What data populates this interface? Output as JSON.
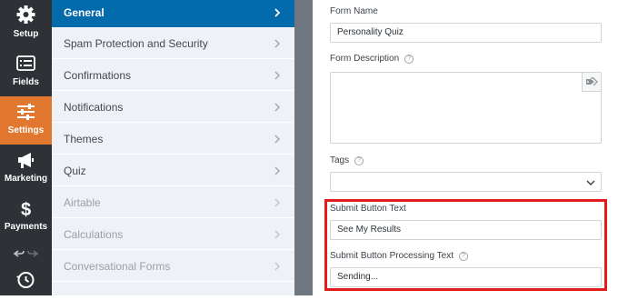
{
  "sidebar": {
    "items": [
      {
        "label": "Setup",
        "icon": "gear-icon"
      },
      {
        "label": "Fields",
        "icon": "list-icon"
      },
      {
        "label": "Settings",
        "icon": "sliders-icon",
        "active": true
      },
      {
        "label": "Marketing",
        "icon": "megaphone-icon"
      },
      {
        "label": "Payments",
        "icon": "dollar-icon"
      }
    ],
    "accent_color": "#e27730"
  },
  "menu": {
    "items": [
      {
        "label": "General",
        "active": true
      },
      {
        "label": "Spam Protection and Security"
      },
      {
        "label": "Confirmations"
      },
      {
        "label": "Notifications"
      },
      {
        "label": "Themes"
      },
      {
        "label": "Quiz"
      },
      {
        "label": "Airtable",
        "disabled": true
      },
      {
        "label": "Calculations",
        "disabled": true
      },
      {
        "label": "Conversational Forms",
        "disabled": true
      }
    ],
    "active_color": "#036aab"
  },
  "form": {
    "name_label": "Form Name",
    "name_value": "Personality Quiz",
    "description_label": "Form Description",
    "tags_label": "Tags",
    "submit_label": "Submit Button Text",
    "submit_value": "See My Results",
    "processing_label": "Submit Button Processing Text",
    "processing_value": "Sending...",
    "highlight_color": "#e21b1b"
  }
}
